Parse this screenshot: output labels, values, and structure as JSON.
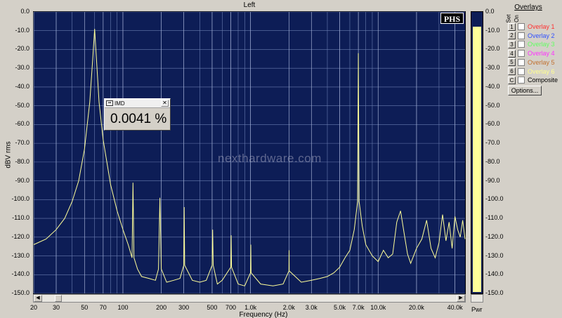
{
  "window": {
    "title": "Left"
  },
  "plot": {
    "y_axis_label": "dBV rms",
    "x_axis_label": "Frequency (Hz)",
    "watermark": "nexthardware.com",
    "badge": "PHS"
  },
  "imd_meter": {
    "title": "IMD",
    "value": "0.0041 %"
  },
  "power_meter": {
    "label": "Pwr",
    "level_dbv": -8,
    "ticks": [
      "0.0",
      "-10.0",
      "-20.0",
      "-30.0",
      "-40.0",
      "-50.0",
      "-60.0",
      "-70.0",
      "-80.0",
      "-90.0",
      "-100.0",
      "-110.0",
      "-120.0",
      "-130.0",
      "-140.0",
      "-150.0"
    ]
  },
  "overlays": {
    "title": "Overlays",
    "set_header": "Set",
    "on_header": "On",
    "items": [
      {
        "num": "1",
        "label": "Overlay 1",
        "color": "#ff3030"
      },
      {
        "num": "2",
        "label": "Overlay 2",
        "color": "#3050ff"
      },
      {
        "num": "3",
        "label": "Overlay 3",
        "color": "#60ff60"
      },
      {
        "num": "4",
        "label": "Overlay 4",
        "color": "#ff30ff"
      },
      {
        "num": "5",
        "label": "Overlay 5",
        "color": "#c07030"
      },
      {
        "num": "6",
        "label": "Overlay 6",
        "color": "#ffff90"
      },
      {
        "num": "C",
        "label": "Composite",
        "color": "#000000"
      }
    ],
    "options_label": "Options..."
  },
  "chart_data": {
    "type": "line",
    "title": "Left",
    "xlabel": "Frequency (Hz)",
    "ylabel": "dBV rms",
    "x_scale": "log",
    "xlim": [
      20,
      48000
    ],
    "ylim": [
      -150,
      0
    ],
    "grid": true,
    "x_tick_labels": [
      "20",
      "30",
      "50",
      "70",
      "100",
      "200",
      "300",
      "500",
      "700",
      "1.0k",
      "2.0k",
      "3.0k",
      "5.0k",
      "7.0k",
      "10.0k",
      "20.0k",
      "40.0k"
    ],
    "x_tick_values": [
      20,
      30,
      50,
      70,
      100,
      200,
      300,
      500,
      700,
      1000,
      2000,
      3000,
      5000,
      7000,
      10000,
      20000,
      40000
    ],
    "y_tick_labels": [
      "0.0",
      "-10.0",
      "-20.0",
      "-30.0",
      "-40.0",
      "-50.0",
      "-60.0",
      "-70.0",
      "-80.0",
      "-90.0",
      "-100.0",
      "-110.0",
      "-120.0",
      "-130.0",
      "-140.0",
      "-150.0"
    ],
    "y_tick_values": [
      0,
      -10,
      -20,
      -30,
      -40,
      -50,
      -60,
      -70,
      -80,
      -90,
      -100,
      -110,
      -120,
      -130,
      -140,
      -150
    ],
    "series": [
      {
        "color": "#ffff99",
        "points": [
          [
            20,
            -124
          ],
          [
            25,
            -121
          ],
          [
            30,
            -116
          ],
          [
            35,
            -110
          ],
          [
            40,
            -101
          ],
          [
            45,
            -90
          ],
          [
            50,
            -73
          ],
          [
            55,
            -48
          ],
          [
            58,
            -25
          ],
          [
            60,
            -9
          ],
          [
            62,
            -25
          ],
          [
            65,
            -48
          ],
          [
            70,
            -68
          ],
          [
            80,
            -92
          ],
          [
            90,
            -106
          ],
          [
            100,
            -116
          ],
          [
            110,
            -124
          ],
          [
            118,
            -131
          ],
          [
            120,
            -91
          ],
          [
            122,
            -131
          ],
          [
            130,
            -137
          ],
          [
            140,
            -141
          ],
          [
            160,
            -142
          ],
          [
            180,
            -143
          ],
          [
            190,
            -137
          ],
          [
            195,
            -99
          ],
          [
            200,
            -137
          ],
          [
            220,
            -144
          ],
          [
            250,
            -143
          ],
          [
            280,
            -142
          ],
          [
            300,
            -135
          ],
          [
            302,
            -104
          ],
          [
            305,
            -135
          ],
          [
            350,
            -143
          ],
          [
            400,
            -144
          ],
          [
            450,
            -143
          ],
          [
            500,
            -135
          ],
          [
            505,
            -116
          ],
          [
            510,
            -135
          ],
          [
            550,
            -145
          ],
          [
            600,
            -143
          ],
          [
            700,
            -136
          ],
          [
            705,
            -119
          ],
          [
            710,
            -136
          ],
          [
            800,
            -145
          ],
          [
            900,
            -146
          ],
          [
            1000,
            -139
          ],
          [
            1005,
            -124
          ],
          [
            1010,
            -139
          ],
          [
            1200,
            -145
          ],
          [
            1500,
            -146
          ],
          [
            1800,
            -145
          ],
          [
            2000,
            -138
          ],
          [
            2005,
            -127
          ],
          [
            2010,
            -138
          ],
          [
            2500,
            -144
          ],
          [
            3000,
            -143
          ],
          [
            3500,
            -142
          ],
          [
            4000,
            -141
          ],
          [
            4500,
            -139
          ],
          [
            5000,
            -136
          ],
          [
            5500,
            -131
          ],
          [
            6000,
            -127
          ],
          [
            6500,
            -116
          ],
          [
            6900,
            -101
          ],
          [
            7000,
            -22
          ],
          [
            7100,
            -101
          ],
          [
            7500,
            -114
          ],
          [
            8000,
            -124
          ],
          [
            9000,
            -130
          ],
          [
            10000,
            -133
          ],
          [
            11000,
            -127
          ],
          [
            12000,
            -131
          ],
          [
            13000,
            -129
          ],
          [
            14000,
            -112
          ],
          [
            15000,
            -106
          ],
          [
            16000,
            -118
          ],
          [
            17000,
            -129
          ],
          [
            18000,
            -134
          ],
          [
            20000,
            -126
          ],
          [
            22000,
            -121
          ],
          [
            24000,
            -111
          ],
          [
            26000,
            -126
          ],
          [
            28000,
            -131
          ],
          [
            30000,
            -123
          ],
          [
            32000,
            -108
          ],
          [
            34000,
            -122
          ],
          [
            36000,
            -112
          ],
          [
            38000,
            -126
          ],
          [
            40000,
            -109
          ],
          [
            42000,
            -116
          ],
          [
            44000,
            -120
          ],
          [
            46000,
            -111
          ],
          [
            48000,
            -121
          ]
        ]
      }
    ]
  }
}
